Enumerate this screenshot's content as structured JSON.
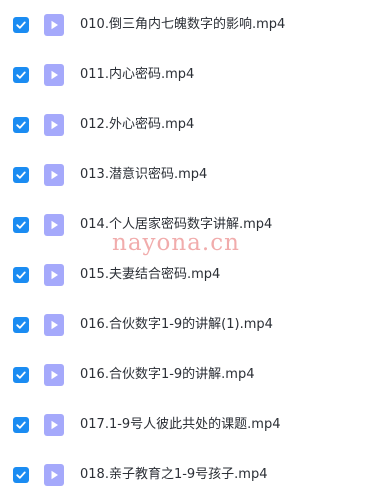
{
  "colors": {
    "checkbox_fill": "#1b8cf2",
    "icon_fill": "#a5a9fb",
    "text": "#2b2f36",
    "watermark": "#e66868"
  },
  "icons": {
    "checkbox": "checkmark-icon",
    "file": "video-file-icon"
  },
  "files": [
    {
      "name": "010.倒三角内七魄数字的影响.mp4",
      "checked": true
    },
    {
      "name": "011.内心密码.mp4",
      "checked": true
    },
    {
      "name": "012.外心密码.mp4",
      "checked": true
    },
    {
      "name": "013.潜意识密码.mp4",
      "checked": true
    },
    {
      "name": "014.个人居家密码数字讲解.mp4",
      "checked": true
    },
    {
      "name": "015.夫妻结合密码.mp4",
      "checked": true
    },
    {
      "name": "016.合伙数字1-9的讲解(1).mp4",
      "checked": true
    },
    {
      "name": "016.合伙数字1-9的讲解.mp4",
      "checked": true
    },
    {
      "name": "017.1-9号人彼此共处的课题.mp4",
      "checked": true
    },
    {
      "name": "018.亲子教育之1-9号孩子.mp4",
      "checked": true
    }
  ],
  "watermark": "nayona.cn"
}
